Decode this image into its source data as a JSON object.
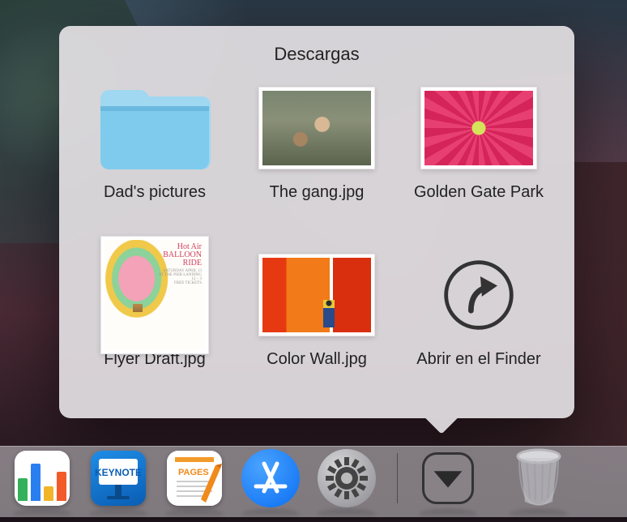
{
  "stack": {
    "title": "Descargas",
    "items": [
      {
        "label": "Dad's pictures",
        "kind": "folder"
      },
      {
        "label": "The gang.jpg",
        "kind": "image"
      },
      {
        "label": "Golden Gate Park",
        "kind": "image"
      },
      {
        "label": "Flyer Draft.jpg",
        "kind": "image"
      },
      {
        "label": "Color Wall.jpg",
        "kind": "image"
      }
    ],
    "open_in_finder_label": "Abrir en el Finder",
    "flyer_title": "Hot Air",
    "flyer_subtitle": "BALLOON RIDE"
  },
  "dock": {
    "apps": [
      {
        "name": "Numbers"
      },
      {
        "name": "Keynote"
      },
      {
        "name": "Pages"
      },
      {
        "name": "App Store"
      },
      {
        "name": "System Preferences"
      }
    ],
    "downloads_name": "Downloads",
    "trash_name": "Trash"
  }
}
